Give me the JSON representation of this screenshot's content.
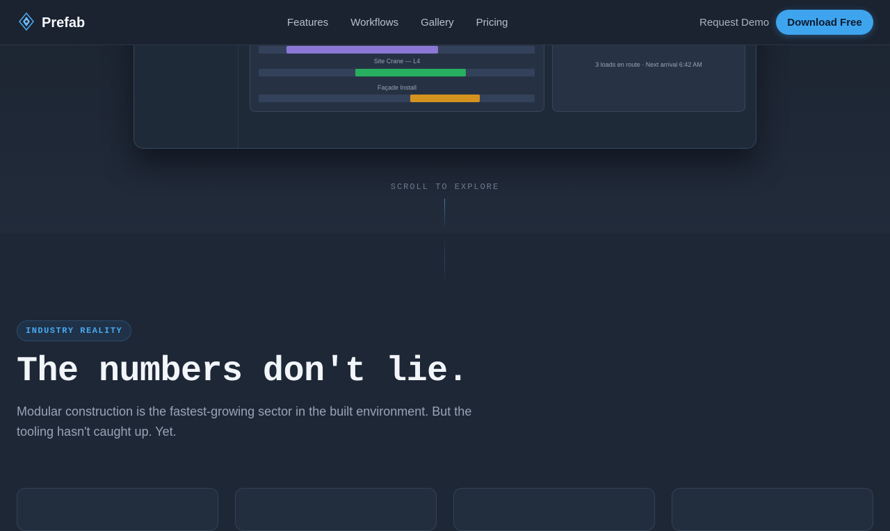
{
  "brand": {
    "name": "Prefab",
    "icon": "diamond-logo-icon",
    "accent": "#3ea4ee"
  },
  "nav": {
    "links": [
      "Features",
      "Workflows",
      "Gallery",
      "Pricing"
    ],
    "request_demo": "Request Demo",
    "download": "Download Free"
  },
  "mockup": {
    "schedule": {
      "rows": [
        {
          "label": "",
          "color": "#8b78d6"
        },
        {
          "label": "Site Crane — L4",
          "color": "#27ae5f"
        },
        {
          "label": "Façade Install",
          "color": "#d4921f"
        }
      ]
    },
    "logistics": {
      "status": "3 loads en route · Next arrival 6:42 AM"
    }
  },
  "scroll_cue": "SCROLL TO EXPLORE",
  "section": {
    "badge": "INDUSTRY REALITY",
    "title": "The numbers don't lie.",
    "description": "Modular construction is the fastest-growing sector in the built environment. But the tooling hasn't caught up. Yet."
  }
}
